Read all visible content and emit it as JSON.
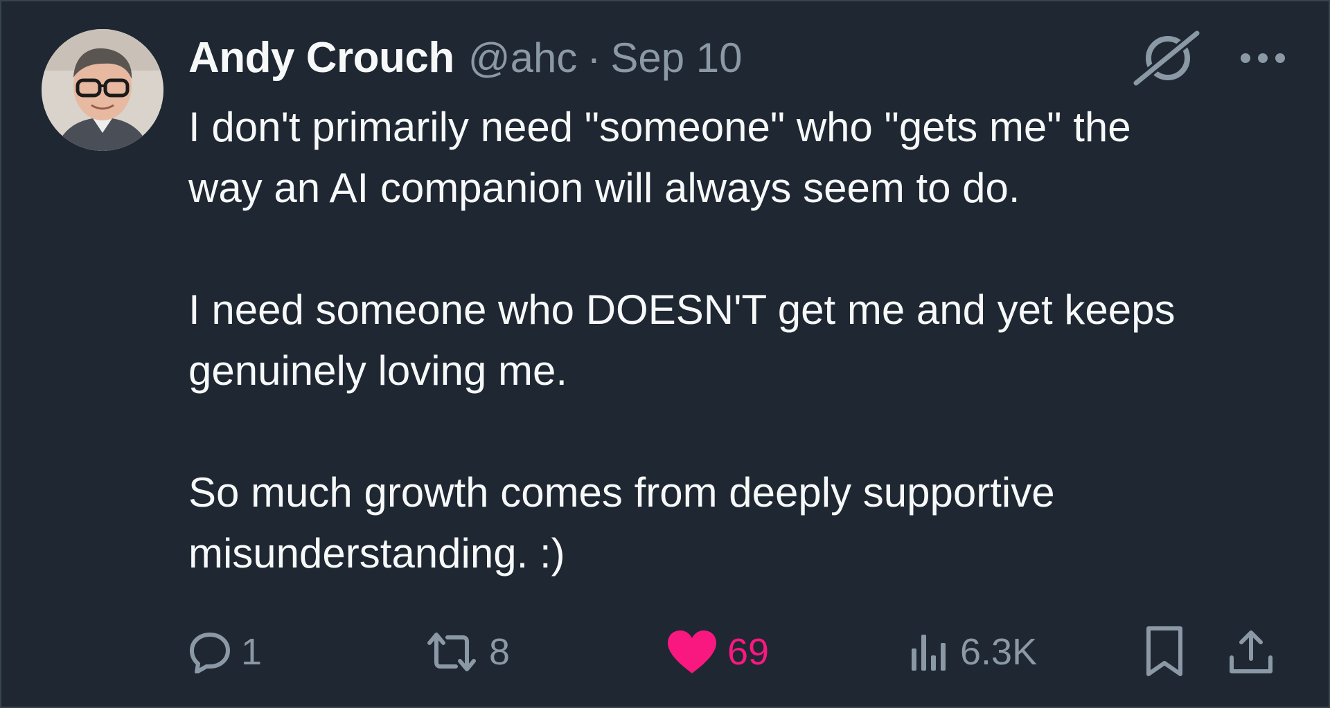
{
  "author": {
    "name": "Andy Crouch",
    "handle": "@ahc",
    "separator": "·",
    "date": "Sep 10"
  },
  "header_icons": {
    "grok": "grok-slash-icon",
    "more": "more-icon"
  },
  "body": {
    "paragraphs": [
      "I don't primarily need \"someone\" who \"gets me\" the\nway an AI companion will always seem to do.",
      "I need someone who DOESN'T get me and yet keeps\ngenuinely loving me.",
      "So much growth comes from deeply supportive\nmisunderstanding. :)"
    ]
  },
  "actions": {
    "reply": {
      "icon": "reply-icon",
      "count": "1"
    },
    "repost": {
      "icon": "repost-icon",
      "count": "8"
    },
    "like": {
      "icon": "heart-icon",
      "count": "69",
      "liked": true
    },
    "views": {
      "icon": "views-icon",
      "count": "6.3K"
    },
    "bookmark": {
      "icon": "bookmark-icon"
    },
    "share": {
      "icon": "share-icon"
    }
  },
  "colors": {
    "background": "#1e2732",
    "text": "#f7f9f9",
    "secondary": "#8b98a5",
    "like": "#f91880"
  }
}
